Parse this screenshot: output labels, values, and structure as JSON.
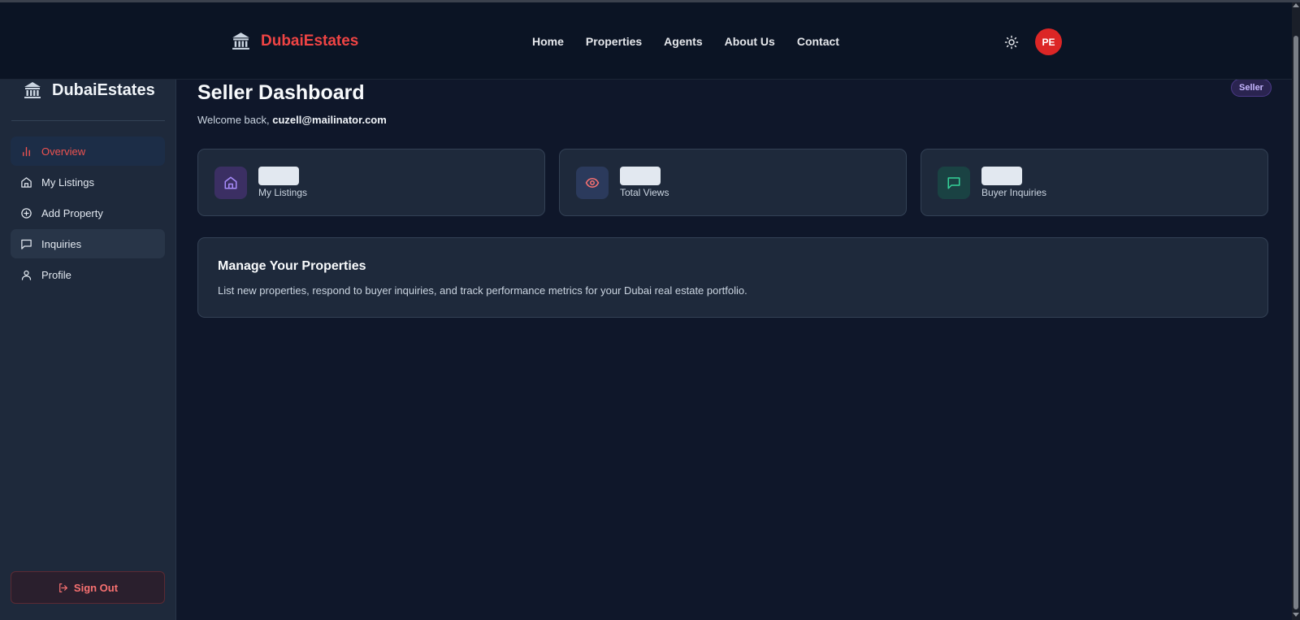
{
  "brand": {
    "name": "DubaiEstates",
    "icon": "bank-icon",
    "color": "#ef4444"
  },
  "topnav": {
    "items": [
      {
        "label": "Home"
      },
      {
        "label": "Properties"
      },
      {
        "label": "Agents"
      },
      {
        "label": "About Us"
      },
      {
        "label": "Contact"
      }
    ],
    "theme_icon": "sun-icon",
    "avatar_initials": "PE"
  },
  "sidebar": {
    "brand": "DubaiEstates",
    "items": [
      {
        "label": "Overview",
        "icon": "bar-chart-icon",
        "active": true
      },
      {
        "label": "My Listings",
        "icon": "home-icon"
      },
      {
        "label": "Add Property",
        "icon": "plus-circle-icon"
      },
      {
        "label": "Inquiries",
        "icon": "message-square-icon",
        "highlighted": true
      },
      {
        "label": "Profile",
        "icon": "user-icon"
      }
    ],
    "signout_label": "Sign Out"
  },
  "main": {
    "title": "Seller Dashboard",
    "role_badge": "Seller",
    "welcome_prefix": "Welcome back, ",
    "user_email": "cuzell@mailinator.com",
    "stats": [
      {
        "label": "My Listings",
        "icon": "home-icon",
        "value": "",
        "accent": "#a78bfa"
      },
      {
        "label": "Total Views",
        "icon": "eye-icon",
        "value": "",
        "accent": "#f87171"
      },
      {
        "label": "Buyer Inquiries",
        "icon": "message-square-icon",
        "value": "",
        "accent": "#34d399"
      }
    ],
    "manage": {
      "title": "Manage Your Properties",
      "description": "List new properties, respond to buyer inquiries, and track performance metrics for your Dubai real estate portfolio."
    }
  }
}
